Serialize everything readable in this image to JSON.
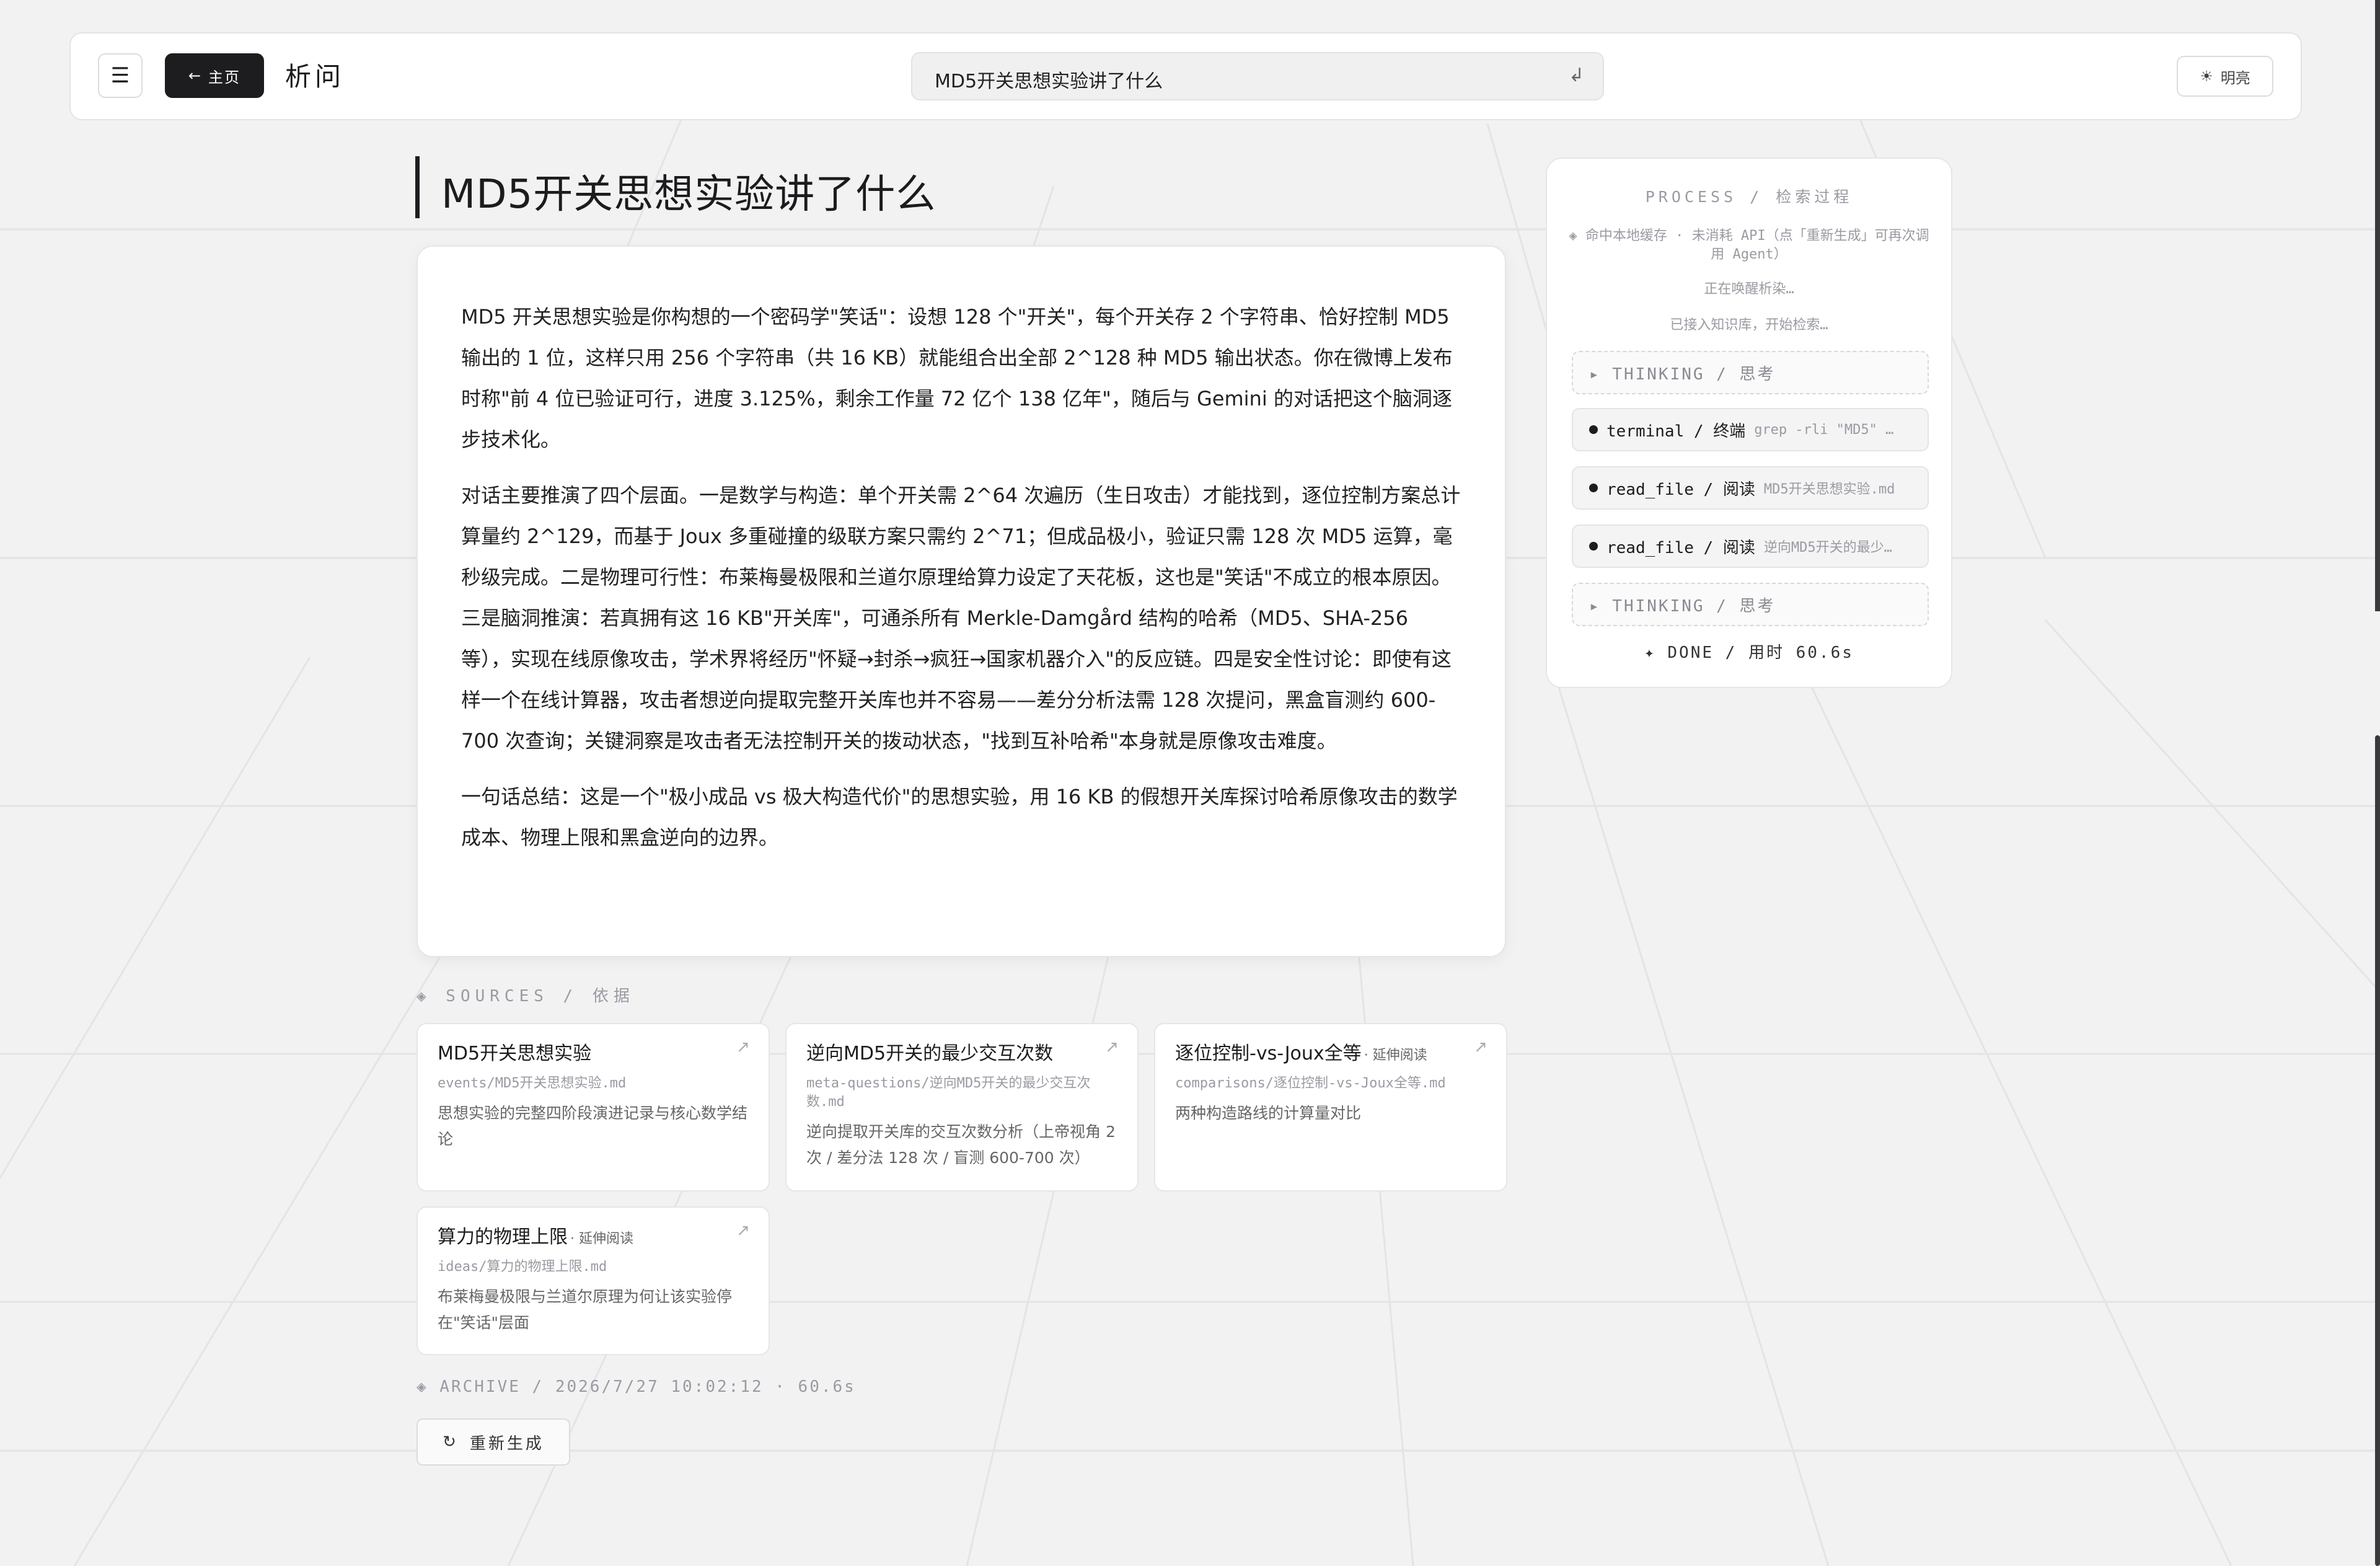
{
  "header": {
    "menu_icon": "☰",
    "home_label": "主页",
    "home_arrow": "←",
    "app_title": "析问",
    "search_value": "MD5开关思想实验讲了什么",
    "enter_icon": "↲",
    "theme_icon": "☀",
    "theme_label": "明亮"
  },
  "question": {
    "title": "MD5开关思想实验讲了什么"
  },
  "answer": {
    "paragraphs": [
      "MD5 开关思想实验是你构想的一个密码学\"笑话\"：设想 128 个\"开关\"，每个开关存 2 个字符串、恰好控制 MD5 输出的 1 位，这样只用 256 个字符串（共 16 KB）就能组合出全部 2^128 种 MD5 输出状态。你在微博上发布时称\"前 4 位已验证可行，进度 3.125%，剩余工作量 72 亿个 138 亿年\"，随后与 Gemini 的对话把这个脑洞逐步技术化。",
      "对话主要推演了四个层面。一是数学与构造：单个开关需 2^64 次遍历（生日攻击）才能找到，逐位控制方案总计算量约 2^129，而基于 Joux 多重碰撞的级联方案只需约 2^71；但成品极小，验证只需 128 次 MD5 运算，毫秒级完成。二是物理可行性：布莱梅曼极限和兰道尔原理给算力设定了天花板，这也是\"笑话\"不成立的根本原因。三是脑洞推演：若真拥有这 16 KB\"开关库\"，可通杀所有 Merkle-Damgård 结构的哈希（MD5、SHA-256 等），实现在线原像攻击，学术界将经历\"怀疑→封杀→疯狂→国家机器介入\"的反应链。四是安全性讨论：即使有这样一个在线计算器，攻击者想逆向提取完整开关库也并不容易——差分分析法需 128 次提问，黑盒盲测约 600-700 次查询；关键洞察是攻击者无法控制开关的拨动状态，\"找到互补哈希\"本身就是原像攻击难度。",
      "一句话总结：这是一个\"极小成品 vs 极大构造代价\"的思想实验，用 16 KB 的假想开关库探讨哈希原像攻击的数学成本、物理上限和黑盒逆向的边界。"
    ]
  },
  "sources": {
    "heading": "◈  SOURCES  /  依据",
    "items": [
      {
        "title": "MD5开关思想实验",
        "tag": "",
        "path": "events/MD5开关思想实验.md",
        "desc": "思想实验的完整四阶段演进记录与核心数学结论"
      },
      {
        "title": "逆向MD5开关的最少交互次数",
        "tag": "",
        "path": "meta-questions/逆向MD5开关的最少交互次数.md",
        "desc": "逆向提取开关库的交互次数分析（上帝视角 2 次 / 差分法 128 次 / 盲测 600-700 次）"
      },
      {
        "title": "逐位控制-vs-Joux全等",
        "tag": "· 延伸阅读",
        "path": "comparisons/逐位控制-vs-Joux全等.md",
        "desc": "两种构造路线的计算量对比"
      },
      {
        "title": "算力的物理上限",
        "tag": "· 延伸阅读",
        "path": "ideas/算力的物理上限.md",
        "desc": "布莱梅曼极限与兰道尔原理为何让该实验停在\"笑话\"层面"
      }
    ],
    "arrow_icon": "↗"
  },
  "archive": {
    "text": "◈ ARCHIVE / 2026/7/27 10:02:12 · 60.6s"
  },
  "regen": {
    "icon": "↻",
    "label": "重新生成"
  },
  "process": {
    "heading": "PROCESS  /  检索过程",
    "cache_note": "◈ 命中本地缓存 · 未消耗 API（点「重新生成」可再次调用 Agent）",
    "waking": "正在唤醒析染…",
    "connected": "已接入知识库，开始检索…",
    "steps": [
      {
        "kind": "think",
        "label": "▸ THINKING / 思考",
        "arg": ""
      },
      {
        "kind": "tool",
        "label": "terminal / 终端",
        "arg": "grep -rli \"MD5\" …"
      },
      {
        "kind": "tool",
        "label": "read_file / 阅读",
        "arg": "MD5开关思想实验.md"
      },
      {
        "kind": "tool",
        "label": "read_file / 阅读",
        "arg": "逆向MD5开关的最少…"
      },
      {
        "kind": "think",
        "label": "▸ THINKING / 思考",
        "arg": ""
      }
    ],
    "done": "✦ DONE / 用时 60.6s"
  },
  "colors": {
    "accent": "#1d1d20",
    "background": "#f2f2f3",
    "muted": "#9a9aa2"
  }
}
